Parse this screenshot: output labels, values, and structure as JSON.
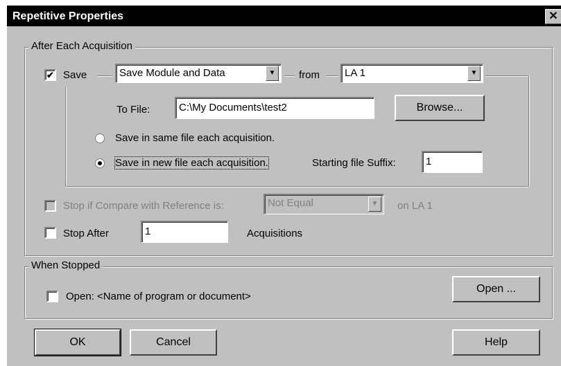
{
  "window": {
    "title": "Repetitive Properties",
    "close_glyph": "✕"
  },
  "after_each": {
    "group_label": "After Each Acquisition",
    "save": {
      "label": "Save",
      "checked": true,
      "check_glyph": "✔"
    },
    "save_mode": {
      "value": "Save Module and Data"
    },
    "from_label": "from",
    "source": {
      "value": "LA 1"
    },
    "to_file_label": "To File:",
    "file_path": "C:\\My Documents\\test2",
    "browse_label": "Browse...",
    "radio_same": {
      "label": "Save in same file each acquisition.",
      "selected": false
    },
    "radio_new": {
      "label": "Save in new file each acquisition.",
      "selected": true
    },
    "suffix_label": "Starting file Suffix:",
    "suffix_value": "1",
    "stop_compare": {
      "label": "Stop if Compare with Reference is:",
      "value": "Not Equal",
      "on_label": "on LA 1"
    },
    "stop_after": {
      "label": "Stop After",
      "value": "1",
      "unit": "Acquisitions"
    }
  },
  "when_stopped": {
    "group_label": "When Stopped",
    "open_check_label": "Open: <Name of program or document>",
    "open_button": "Open ..."
  },
  "footer": {
    "ok": "OK",
    "cancel": "Cancel",
    "help": "Help"
  },
  "icons": {
    "dropdown": "▼"
  }
}
